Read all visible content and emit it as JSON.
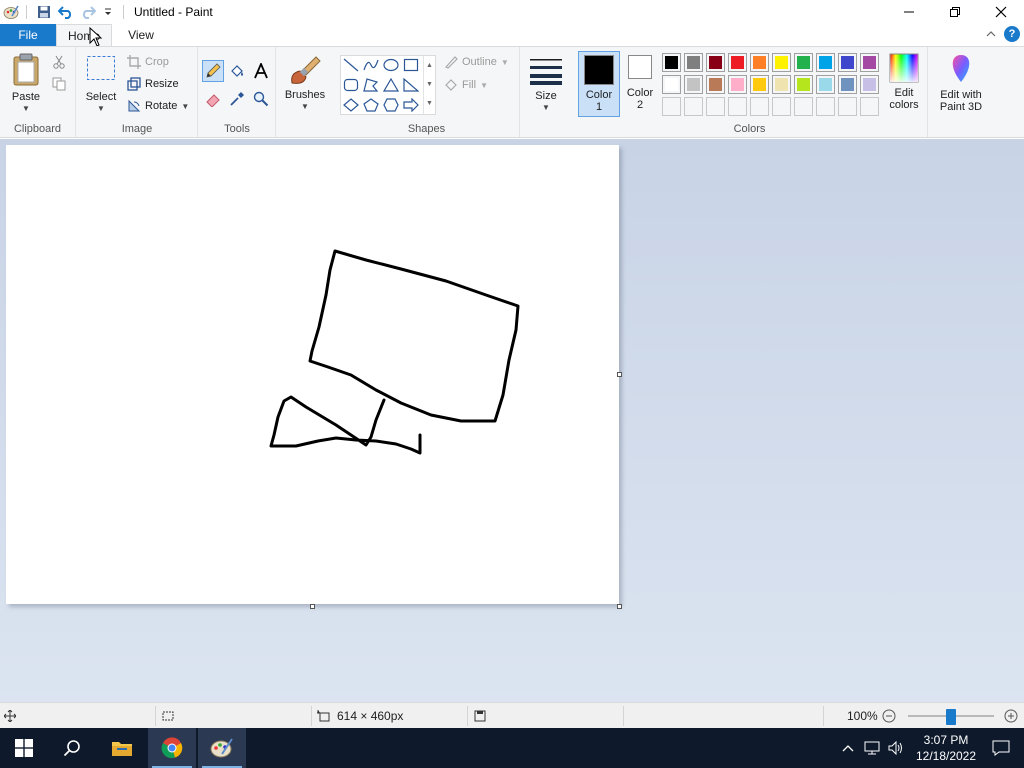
{
  "window": {
    "title": "Untitled - Paint",
    "minimize": "—",
    "restore": "❐",
    "close": "✕"
  },
  "tabs": {
    "file": "File",
    "home": "Home",
    "view": "View"
  },
  "ribbon": {
    "clipboard": {
      "label": "Clipboard",
      "paste": "Paste"
    },
    "image": {
      "label": "Image",
      "select": "Select",
      "crop": "Crop",
      "resize": "Resize",
      "rotate": "Rotate"
    },
    "tools": {
      "label": "Tools"
    },
    "brushes": {
      "label": "Brushes"
    },
    "shapes": {
      "label": "Shapes",
      "outline": "Outline",
      "fill": "Fill"
    },
    "size": {
      "label": "Size"
    },
    "colors": {
      "label": "Colors",
      "color1": "Color",
      "color1_num": "1",
      "color2": "Color",
      "color2_num": "2",
      "edit_colors": "Edit",
      "edit_colors_2": "colors",
      "color1_value": "#000000",
      "color2_value": "#ffffff",
      "row1": [
        "#000000",
        "#7f7f7f",
        "#880015",
        "#ed1c24",
        "#ff7f27",
        "#fff200",
        "#22b14c",
        "#00a2e8",
        "#3f48cc",
        "#a349a4"
      ],
      "row2": [
        "#ffffff",
        "#c3c3c3",
        "#b97a57",
        "#ffaec9",
        "#ffc90e",
        "#efe4b0",
        "#b5e61d",
        "#99d9ea",
        "#7092be",
        "#c8bfe7"
      ]
    },
    "paint3d": {
      "line1": "Edit with",
      "line2": "Paint 3D"
    }
  },
  "status": {
    "dimensions": "614 × 460px",
    "zoom": "100%"
  },
  "taskbar": {
    "time": "3:07 PM",
    "date": "12/18/2022"
  }
}
